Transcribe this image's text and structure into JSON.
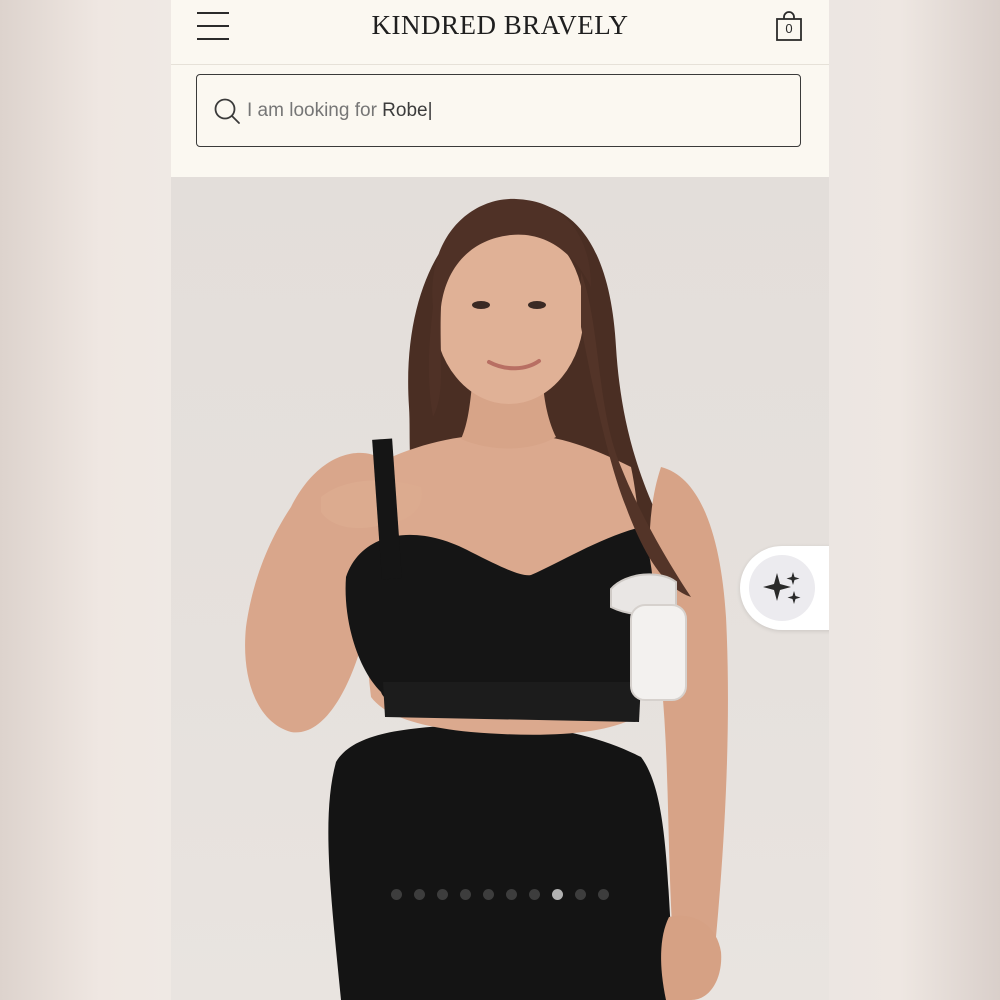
{
  "header": {
    "brand": "KINDRED BRAVELY",
    "menu_icon": "hamburger-menu-icon",
    "cart_icon": "shopping-bag-icon",
    "cart_count": "0"
  },
  "search": {
    "icon": "search-icon",
    "placeholder_prefix": "I am looking for ",
    "value": "Robe",
    "caret": "|"
  },
  "product": {
    "image_description": "model-wearing-black-nursing-bra-with-pump",
    "ai_button_icon": "sparkles-icon",
    "carousel": {
      "total_slides": 10,
      "active_index": 7
    }
  },
  "colors": {
    "header_bg": "#fbf8f1",
    "text": "#1f1f1f",
    "product_bg": "#e4dfdb"
  }
}
